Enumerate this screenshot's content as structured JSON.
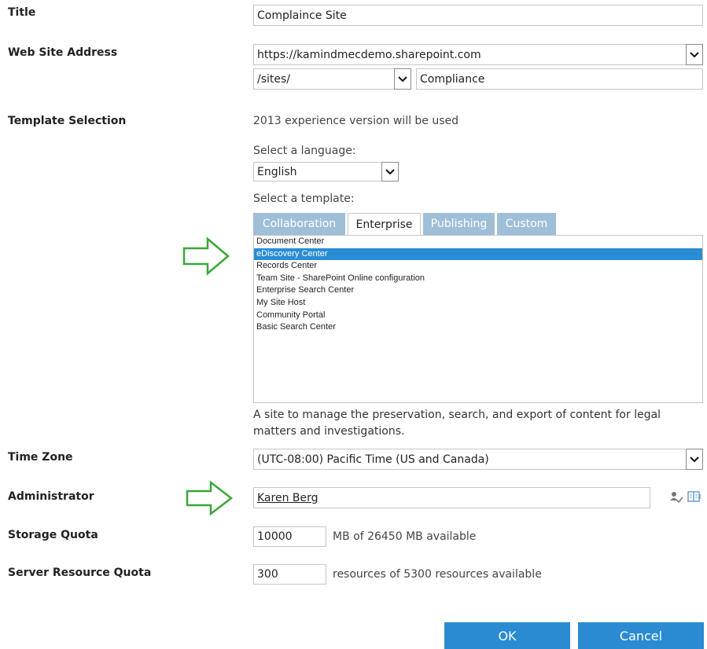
{
  "labels": {
    "title": "Title",
    "web_address": "Web Site Address",
    "template": "Template Selection",
    "timezone": "Time Zone",
    "administrator": "Administrator",
    "storage": "Storage Quota",
    "server_resource": "Server Resource Quota"
  },
  "title_field": {
    "value": "Complaince Site"
  },
  "web_address": {
    "domain": "https://kamindmecdemo.sharepoint.com",
    "path": "/sites/",
    "site_name": "Compliance"
  },
  "template_section": {
    "experience_note": "2013 experience version will be used",
    "language_label": "Select a language:",
    "language_value": "English",
    "template_label": "Select a template:",
    "tabs": [
      "Collaboration",
      "Enterprise",
      "Publishing",
      "Custom"
    ],
    "active_tab": "Enterprise",
    "templates": [
      "Document Center",
      "eDiscovery Center",
      "Records Center",
      "Team Site - SharePoint Online configuration",
      "Enterprise Search Center",
      "My Site Host",
      "Community Portal",
      "Basic Search Center"
    ],
    "selected_template": "eDiscovery Center",
    "description": "A site to manage the preservation, search, and export of content for legal matters and investigations."
  },
  "timezone": {
    "value": "(UTC-08:00) Pacific Time (US and Canada)"
  },
  "administrator": {
    "value": "Karen Berg"
  },
  "storage": {
    "value": "10000",
    "suffix": "MB of 26450 MB available"
  },
  "server_resource": {
    "value": "300",
    "suffix": "resources of 5300 resources available"
  },
  "buttons": {
    "ok": "OK",
    "cancel": "Cancel"
  },
  "colors": {
    "accent": "#2a8ad2",
    "arrow": "#3aa63a",
    "tab_inactive": "#9fbfd9"
  }
}
